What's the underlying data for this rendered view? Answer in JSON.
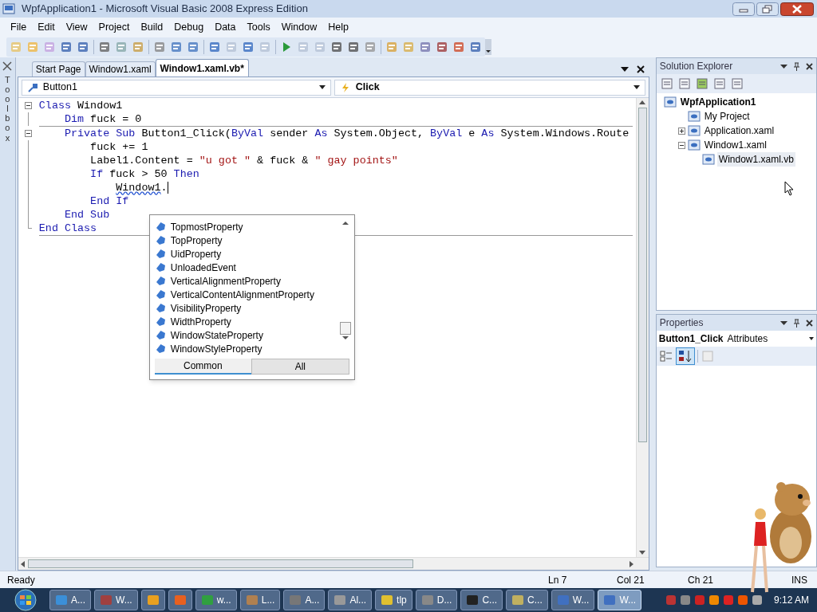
{
  "window": {
    "title": "WpfApplication1 - Microsoft Visual Basic 2008 Express Edition"
  },
  "menu": [
    "File",
    "Edit",
    "View",
    "Project",
    "Build",
    "Debug",
    "Data",
    "Tools",
    "Window",
    "Help"
  ],
  "toolbox_label": "Toolbox",
  "tabs": [
    {
      "label": "Start Page",
      "selected": false
    },
    {
      "label": "Window1.xaml",
      "selected": false
    },
    {
      "label": "Window1.xaml.vb*",
      "selected": true
    }
  ],
  "class_dropdown": "Button1",
  "method_dropdown": "Click",
  "code": [
    {
      "foldable": true,
      "tokens": [
        {
          "kind": "keyword",
          "t": "Class"
        },
        {
          "kind": "plain",
          "t": " Window1"
        }
      ]
    },
    {
      "foldable": false,
      "tokens": [
        {
          "kind": "keyword",
          "t": "    Dim"
        },
        {
          "kind": "plain",
          "t": " fuck = 0"
        }
      ]
    },
    {
      "foldable": true,
      "tokens": [
        {
          "kind": "keyword",
          "t": "    Private Sub"
        },
        {
          "kind": "plain",
          "t": " Button1_Click("
        },
        {
          "kind": "keyword",
          "t": "ByVal"
        },
        {
          "kind": "plain",
          "t": " sender "
        },
        {
          "kind": "keyword",
          "t": "As"
        },
        {
          "kind": "plain",
          "t": " System.Object, "
        },
        {
          "kind": "keyword",
          "t": "ByVal"
        },
        {
          "kind": "plain",
          "t": " e "
        },
        {
          "kind": "keyword",
          "t": "As"
        },
        {
          "kind": "plain",
          "t": " System.Windows.Route"
        }
      ]
    },
    {
      "foldable": false,
      "tokens": [
        {
          "kind": "plain",
          "t": "        fuck += 1"
        }
      ]
    },
    {
      "foldable": false,
      "tokens": [
        {
          "kind": "plain",
          "t": "        Label1.Content = "
        },
        {
          "kind": "string",
          "t": "\"u got \""
        },
        {
          "kind": "plain",
          "t": " & fuck & "
        },
        {
          "kind": "string",
          "t": "\" gay points\""
        }
      ]
    },
    {
      "foldable": false,
      "tokens": [
        {
          "kind": "keyword",
          "t": "        If"
        },
        {
          "kind": "plain",
          "t": " fuck > 50 "
        },
        {
          "kind": "keyword",
          "t": "Then"
        }
      ]
    },
    {
      "foldable": false,
      "tokens": [
        {
          "kind": "error",
          "t": "            Window1"
        },
        {
          "kind": "plain",
          "t": "."
        }
      ]
    },
    {
      "foldable": false,
      "tokens": [
        {
          "kind": "keyword",
          "t": "        End If"
        }
      ]
    },
    {
      "foldable": false,
      "tokens": [
        {
          "kind": "keyword",
          "t": "    End Sub"
        }
      ]
    },
    {
      "foldable": false,
      "tokens": [
        {
          "kind": "keyword",
          "t": "End Class"
        }
      ]
    }
  ],
  "completion": {
    "items": [
      "TopmostProperty",
      "TopProperty",
      "UidProperty",
      "UnloadedEvent",
      "VerticalAlignmentProperty",
      "VerticalContentAlignmentProperty",
      "VisibilityProperty",
      "WidthProperty",
      "WindowStateProperty",
      "WindowStyleProperty"
    ],
    "tabs": [
      {
        "label": "Common",
        "selected": true
      },
      {
        "label": "All",
        "selected": false
      }
    ]
  },
  "solution_explorer": {
    "title": "Solution Explorer",
    "tree": [
      {
        "label": "WpfApplication1",
        "selected": false,
        "children": [
          {
            "label": "My Project",
            "selected": false
          },
          {
            "label": "Application.xaml",
            "expanded": false,
            "selected": false
          },
          {
            "label": "Window1.xaml",
            "expanded": true,
            "selected": false,
            "children": [
              {
                "label": "Window1.xaml.vb",
                "selected": true
              }
            ]
          }
        ]
      }
    ]
  },
  "properties": {
    "title": "Properties",
    "object": "Button1_Click",
    "object_type": "Attributes",
    "sort_alphabetical": true
  },
  "status_bar": {
    "text": "Ready",
    "line": "Ln 7",
    "column": "Col 21",
    "char": "Ch 21",
    "mode": "INS"
  },
  "taskbar": {
    "items": [
      {
        "label": "A...",
        "selected": false
      },
      {
        "label": "W...",
        "selected": false
      },
      {
        "selected": false
      },
      {
        "selected": false
      },
      {
        "label": "w...",
        "selected": false
      },
      {
        "label": "L...",
        "selected": false
      },
      {
        "label": "A...",
        "selected": false
      },
      {
        "label": "Al...",
        "selected": false
      },
      {
        "label": "tlp",
        "selected": false
      },
      {
        "label": "D...",
        "selected": false
      },
      {
        "label": "C...",
        "selected": false
      },
      {
        "label": "C...",
        "selected": false
      },
      {
        "label": "W...",
        "selected": false
      },
      {
        "label": "W...",
        "selected": true
      }
    ],
    "clock": "9:12 AM"
  }
}
